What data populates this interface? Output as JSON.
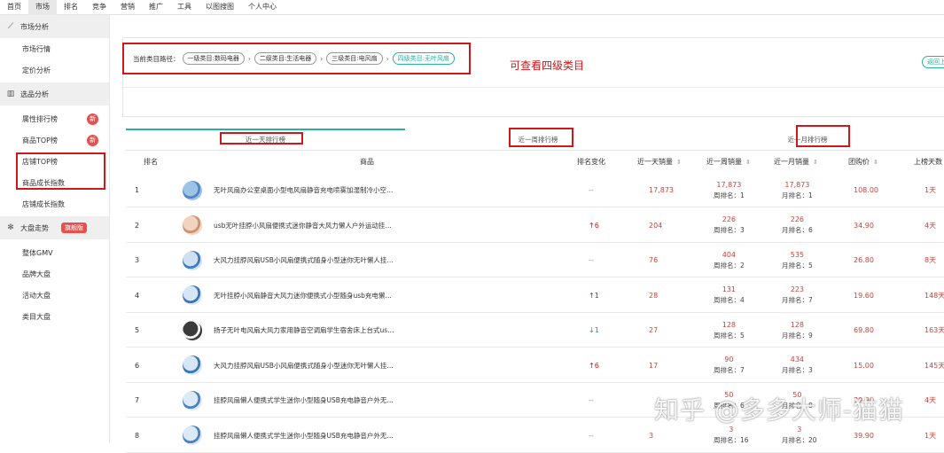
{
  "topnav": [
    "首页",
    "市场",
    "排名",
    "竞争",
    "营销",
    "推广",
    "工具",
    "以图搜图",
    "个人中心"
  ],
  "topnav_active": 1,
  "sidebar": {
    "market_head": "市场分析",
    "market_items": [
      "市场行情",
      "定价分析"
    ],
    "select_head": "选品分析",
    "select_items": [
      "属性排行榜",
      "商品TOP榜",
      "店铺TOP榜",
      "商品成长指数",
      "店铺成长指数"
    ],
    "new_badge": "新",
    "trend_head": "大盘走势",
    "trend_badge": "旗舰版",
    "trend_items": [
      "整体GMV",
      "品牌大盘",
      "活动大盘",
      "类目大盘"
    ]
  },
  "path": {
    "label": "当前类目路径：",
    "chips": [
      "一级类目:数码电器",
      "二级类目:生活电器",
      "三级类目:电风扇",
      "四级类目:无叶风扇"
    ],
    "back": "返回上",
    "annotation": "可查看四级类目"
  },
  "rank_tabs": [
    "近一天排行榜",
    "近一周排行榜",
    "近一月排行榜"
  ],
  "columns": [
    "排名",
    "商品",
    "排名变化",
    "近一天销量",
    "近一周销量",
    "近一月销量",
    "团购价",
    "上榜天数"
  ],
  "rows": [
    {
      "rank": "1",
      "title": "无叶风扇办公室桌面小型电风扇静音充电喷雾加湿制冷小空…",
      "change": "--",
      "dir": "",
      "day": "17,873",
      "week": "17,873",
      "week_rank": "周排名：1",
      "month": "17,873",
      "month_rank": "月排名：1",
      "price": "108.00",
      "days": "1天"
    },
    {
      "rank": "2",
      "title": "usb无叶挂脖小风扇便携式迷你静音大风力懒人户外运动挂…",
      "change": "6",
      "dir": "up",
      "day": "204",
      "week": "226",
      "week_rank": "周排名：3",
      "month": "226",
      "month_rank": "月排名：6",
      "price": "34.90",
      "days": "4天"
    },
    {
      "rank": "3",
      "title": "大风力挂脖风扇USB小风扇便携式随身小型迷你无叶懒人挂…",
      "change": "--",
      "dir": "",
      "day": "76",
      "week": "404",
      "week_rank": "周排名：2",
      "month": "535",
      "month_rank": "月排名：5",
      "price": "26.80",
      "days": "8天"
    },
    {
      "rank": "4",
      "title": "无叶挂脖小风扇静音大风力迷你便携式小型随身usb充电懒…",
      "change": "1",
      "dir": "up",
      "day": "28",
      "week": "131",
      "week_rank": "周排名：4",
      "month": "223",
      "month_rank": "月排名：7",
      "price": "19.60",
      "days": "148天"
    },
    {
      "rank": "5",
      "title": "扬子无叶电风扇大风力家用静音空调扇学生宿舍床上台式us…",
      "change": "1",
      "dir": "down",
      "day": "27",
      "week": "128",
      "week_rank": "周排名：5",
      "month": "128",
      "month_rank": "月排名：9",
      "price": "69.80",
      "days": "163天"
    },
    {
      "rank": "6",
      "title": "大风力挂脖风扇USB小风扇便携式随身小型迷你无叶懒人挂…",
      "change": "6",
      "dir": "up",
      "day": "17",
      "week": "90",
      "week_rank": "周排名：7",
      "month": "434",
      "month_rank": "月排名：3",
      "price": "15.00",
      "days": "145天"
    },
    {
      "rank": "7",
      "title": "挂脖风扇懒人便携式学生迷你小型随身USB充电静音户外无…",
      "change": "--",
      "dir": "",
      "day": "",
      "week": "50",
      "week_rank": "周排名：6",
      "month": "50",
      "month_rank": "月排名：8",
      "price": "39.90",
      "days": "4天"
    },
    {
      "rank": "8",
      "title": "挂脖风扇懒人便携式学生迷你小型随身USB充电静音户外无…",
      "change": "--",
      "dir": "",
      "day": "3",
      "week": "3",
      "week_rank": "周排名：16",
      "month": "3",
      "month_rank": "月排名：20",
      "price": "39.90",
      "days": "1天"
    }
  ],
  "watermark": "知乎 @多多大师-猫猫",
  "colors": {
    "accent": "#2bb1a4",
    "highlight": "#d0181b",
    "number": "#c8453b"
  }
}
